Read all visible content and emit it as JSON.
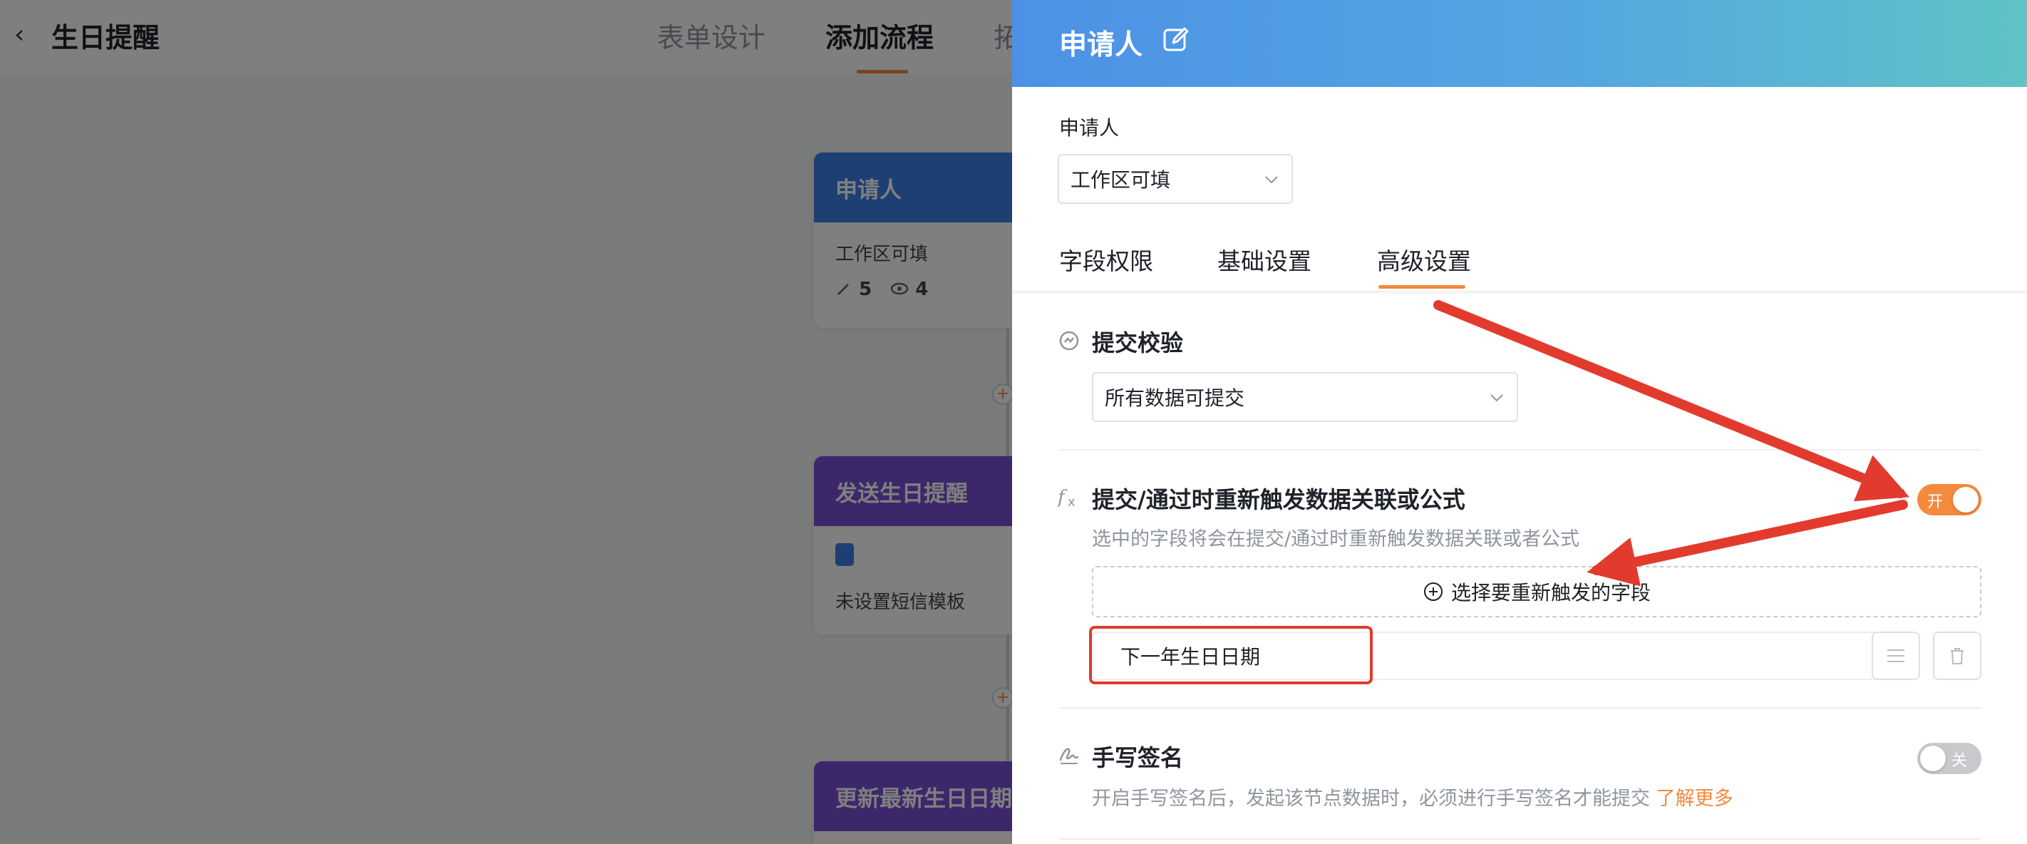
{
  "background": {
    "back_glyph": "‹",
    "app_title": "生日提醒",
    "tabs": [
      "表单设计",
      "添加流程",
      "拓展功能"
    ],
    "active_tab": "添加流程",
    "nodes": [
      {
        "title": "申请人",
        "body": "工作区可填",
        "edit_count": "5",
        "view_count": "4"
      },
      {
        "title": "发送生日提醒",
        "body": "未设置短信模板"
      },
      {
        "title": "更新最新生日日期"
      }
    ],
    "plus_glyph": "+"
  },
  "drawer": {
    "title": "申请人",
    "field_label": "申请人",
    "scope_select": {
      "value": "工作区可填"
    },
    "tabs": [
      "字段权限",
      "基础设置",
      "高级设置"
    ],
    "active_tab": "高级设置",
    "submit_validation": {
      "title": "提交校验",
      "select_value": "所有数据可提交"
    },
    "retrigger": {
      "title": "提交/通过时重新触发数据关联或公式",
      "description": "选中的字段将会在提交/通过时重新触发数据关联或者公式",
      "toggle_label": "开",
      "toggle_on": true,
      "add_field_label": "选择要重新触发的字段",
      "fields": [
        "下一年生日日期"
      ]
    },
    "handwritten_signature": {
      "title": "手写签名",
      "description": "开启手写签名后，发起该节点数据时，必须进行手写签名才能提交",
      "learn_more": "了解更多",
      "toggle_label": "关",
      "toggle_on": false
    }
  },
  "colors": {
    "accent": "#f5893e",
    "header_gradient_start": "#4c91e6",
    "header_gradient_end": "#60c3c6",
    "annotation_red": "#e23b2e"
  }
}
